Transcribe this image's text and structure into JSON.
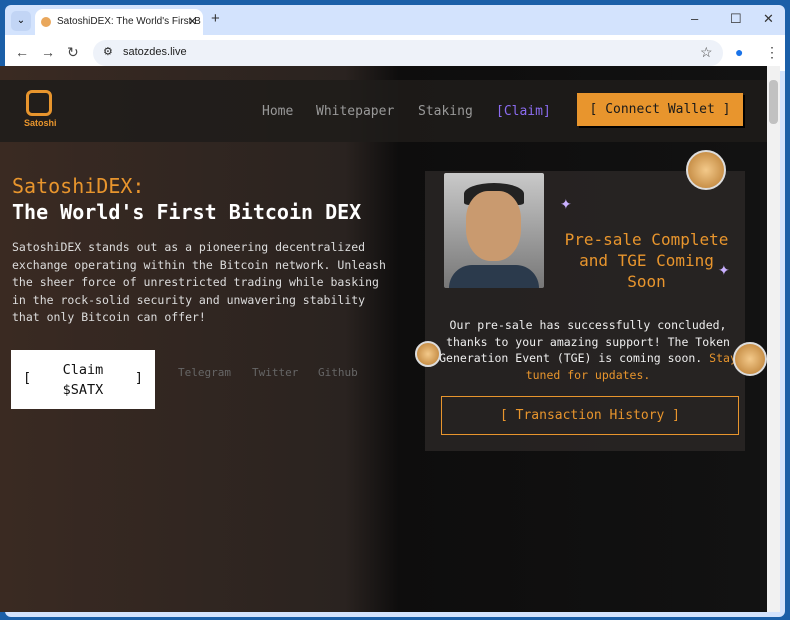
{
  "browser": {
    "tab_title": "SatoshiDEX: The World's First B",
    "url": "satozdes.live"
  },
  "header": {
    "logo_text": "Satoshi",
    "nav": [
      "Home",
      "Whitepaper",
      "Staking",
      "[Claim]"
    ],
    "connect_label": "[ Connect Wallet ]"
  },
  "hero": {
    "title_line1": "SatoshiDEX:",
    "title_line2": "The World's First Bitcoin DEX",
    "description": "SatoshiDEX stands out as a pioneering decentralized exchange operating within the Bitcoin network. Unleash the sheer force of unrestricted trading while basking in the rock-solid security and unwavering stability that only Bitcoin can offer!",
    "claim_open": "[",
    "claim_line1": "Claim",
    "claim_line2": "$SATX",
    "claim_close": "]",
    "social": [
      "Telegram",
      "Twitter",
      "Github"
    ]
  },
  "card": {
    "title": "Pre-sale Complete and TGE Coming Soon",
    "text": "Our pre-sale has successfully concluded, thanks to your amazing support! The Token Generation Event (TGE) is coming soon.",
    "highlight": "Stay tuned for updates.",
    "history_label": "[ Transaction History ]"
  },
  "colors": {
    "accent": "#e8952d",
    "claim_nav": "#8b6cf0"
  }
}
